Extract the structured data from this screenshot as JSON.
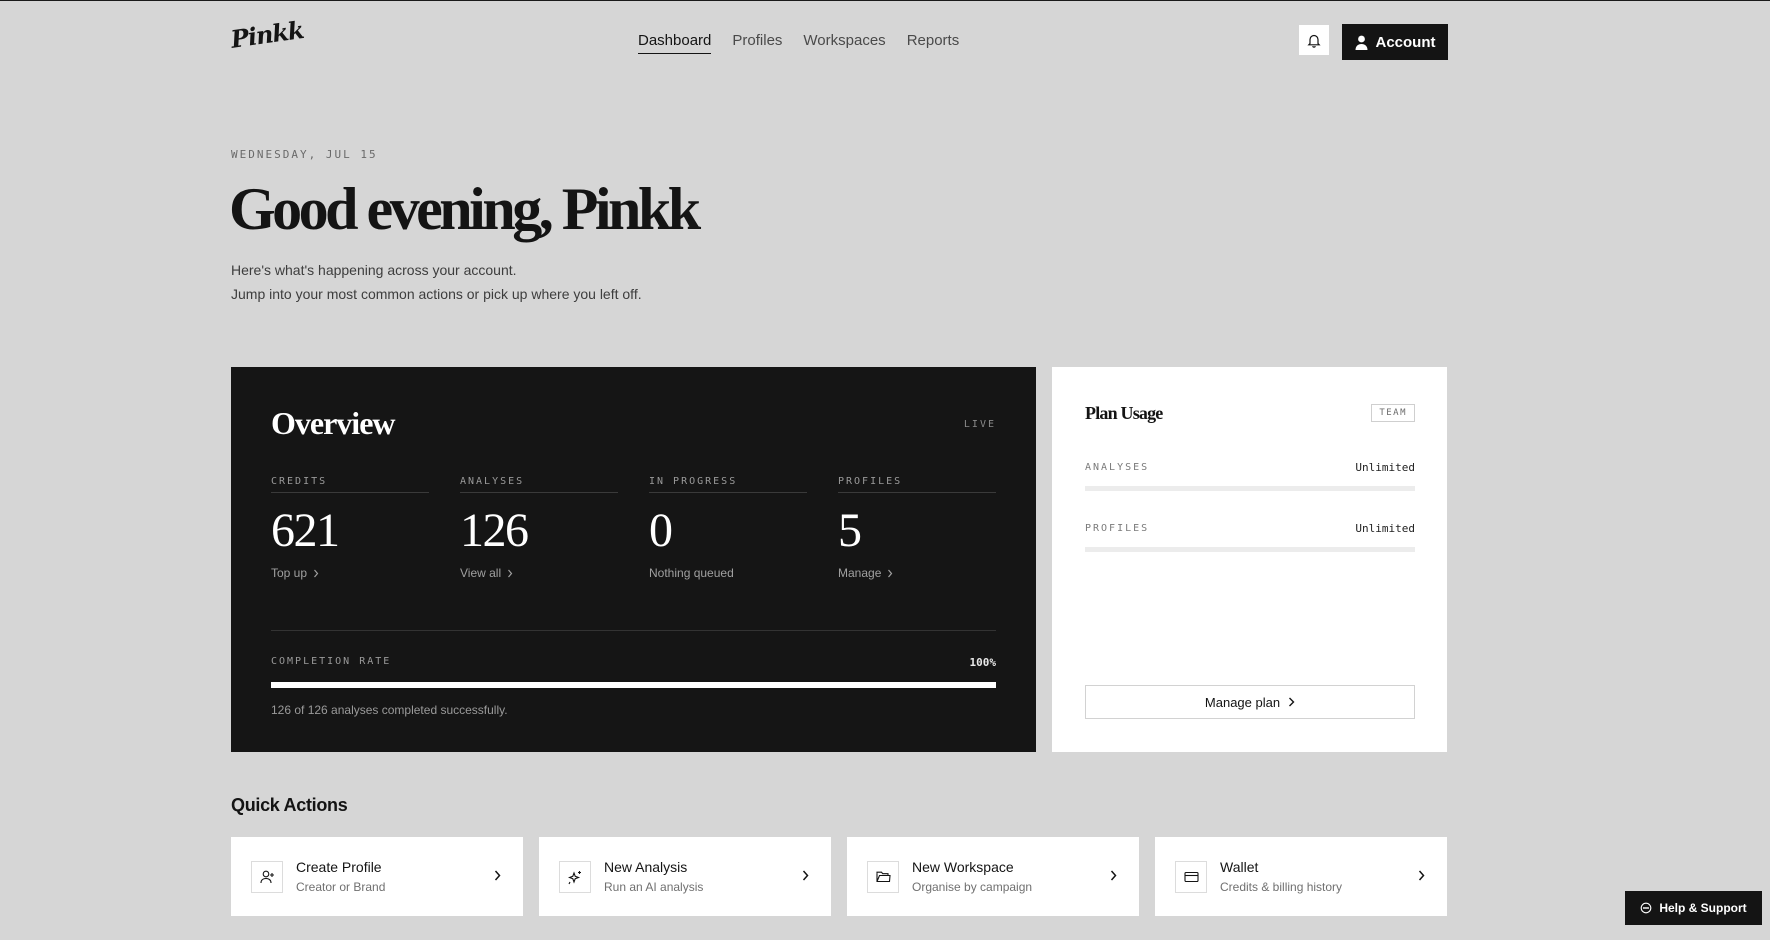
{
  "brand": {
    "logo_text": "Pinkk"
  },
  "nav": {
    "tabs": [
      {
        "label": "Dashboard",
        "active": true
      },
      {
        "label": "Profiles",
        "active": false
      },
      {
        "label": "Workspaces",
        "active": false
      },
      {
        "label": "Reports",
        "active": false
      }
    ],
    "notifications_icon": "bell-icon",
    "account_label": "Account",
    "account_icon": "user-icon"
  },
  "greeting": {
    "date": "WEDNESDAY, JUL 15",
    "title": "Good evening, Pinkk",
    "line1": "Here's what's happening across your account.",
    "line2": "Jump into your most common actions or pick up where you left off."
  },
  "overview": {
    "title": "Overview",
    "status": "LIVE",
    "stats": [
      {
        "label": "CREDITS",
        "value": "621",
        "link": "Top up",
        "has_chevron": true
      },
      {
        "label": "ANALYSES",
        "value": "126",
        "link": "View all",
        "has_chevron": true
      },
      {
        "label": "IN PROGRESS",
        "value": "0",
        "link": "Nothing queued",
        "has_chevron": false
      },
      {
        "label": "PROFILES",
        "value": "5",
        "link": "Manage",
        "has_chevron": true
      }
    ],
    "completion": {
      "label": "COMPLETION RATE",
      "value_text": "100%",
      "fraction": 1.0,
      "caption": "126 of 126 analyses completed successfully."
    }
  },
  "plan": {
    "title": "Plan Usage",
    "badge": "TEAM",
    "rows": [
      {
        "label": "ANALYSES",
        "value": "Unlimited"
      },
      {
        "label": "PROFILES",
        "value": "Unlimited"
      }
    ],
    "manage_label": "Manage plan"
  },
  "quick_actions": {
    "title": "Quick Actions",
    "items": [
      {
        "name": "Create Profile",
        "sub": "Creator or Brand",
        "icon": "user-plus-icon"
      },
      {
        "name": "New Analysis",
        "sub": "Run an AI analysis",
        "icon": "sparkle-icon"
      },
      {
        "name": "New Workspace",
        "sub": "Organise by campaign",
        "icon": "folder-icon"
      },
      {
        "name": "Wallet",
        "sub": "Credits & billing history",
        "icon": "card-icon"
      }
    ]
  },
  "help": {
    "label": "Help & Support",
    "icon": "chat-icon"
  },
  "colors": {
    "background": "#d6d6d6",
    "dark": "#151515",
    "card": "#ffffff"
  }
}
